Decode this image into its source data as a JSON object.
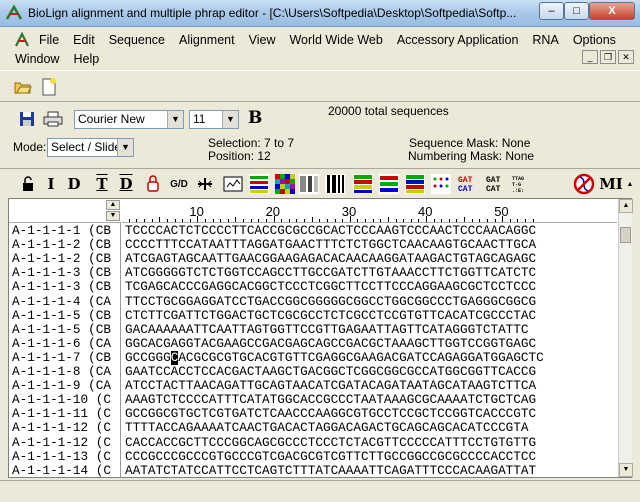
{
  "window": {
    "title": "BioLign alignment and multiple phrap editor - [C:\\Users\\Softpedia\\Desktop\\Softpedia\\Softp...",
    "minimize": "–",
    "maximize": "□",
    "close": "X"
  },
  "menu": {
    "row1": [
      "File",
      "Edit",
      "Sequence",
      "Alignment",
      "View",
      "World Wide Web",
      "Accessory Application",
      "RNA",
      "Options"
    ],
    "row2": [
      "Window",
      "Help"
    ]
  },
  "font_toolbar": {
    "font_name": "Courier New",
    "font_size": "11",
    "bold_label": "B",
    "total_sequences": "20000 total sequences"
  },
  "mode_bar": {
    "mode_label": "Mode:",
    "mode_value": "Select / Slide",
    "selection": "Selection: 7 to 7",
    "position": "Position:  12",
    "sequence_mask": "Sequence Mask: None",
    "numbering_mask": "Numbering Mask: None"
  },
  "edit_toolbar": {
    "labels": [
      "I",
      "D",
      "T",
      "D",
      "G/D"
    ],
    "mi_label": "MI"
  },
  "ruler": {
    "numbers": [
      "10",
      "20",
      "30",
      "40",
      "50"
    ]
  },
  "sequences": [
    {
      "name": "A-1-1-1-1 (CB",
      "seq": "TCCCCACTCTCCCCTTCACCGCGCCGCACTCCCAAGTCCCAACTCCCAACAGGC"
    },
    {
      "name": "A-1-1-1-2 (CB",
      "seq": "CCCCTTTCCATAATTTAGGATGAACTTTCTCTGGCTCAACAAGTGCAACTTGCA"
    },
    {
      "name": "A-1-1-1-2 (CB",
      "seq": "ATCGAGTAGCAATTGAACGGAAGAGACACAACAAGGATAAGACTGTAGCAGAGC"
    },
    {
      "name": "A-1-1-1-3 (CB",
      "seq": "ATCGGGGGTCTCTGGTCCAGCCTTGCCGATCTTGTAAACCTTCTGGTTCATCTC"
    },
    {
      "name": "A-1-1-1-3 (CB",
      "seq": "TCGAGCACCCGAGGCACGGCTCCCTCGGCTTCCTTCCCAGGAAGCGCTCCTCCC"
    },
    {
      "name": "A-1-1-1-4 (CA",
      "seq": "TTCCTGCGGAGGATCCTGACCGGCGGGGGCGGCCTGGCGGCCCTGAGGGCGGCG"
    },
    {
      "name": "A-1-1-1-5 (CB",
      "seq": "CTCTTCGATTCTGGACTGCTCGCGCCTCTCGCCTCCGTGTTCACATCGCCCTAC"
    },
    {
      "name": "A-1-1-1-5 (CB",
      "seq": "GACAAAAAATTCAATTAGTGGTTCCGTTGAGAATTAGTTCATAGGGTCTATTC"
    },
    {
      "name": "A-1-1-1-6 (CA",
      "seq": "GGCACGAGGTACGAAGCCGACGAGCAGCCGACGCTAAAGCTTGGTCCGGTGAGC"
    },
    {
      "name": "A-1-1-1-7 (CB",
      "seq_pre": "GCCGGG",
      "seq_cursor": "C",
      "seq_post": "ACGCGCGTGCACGTGTTCGAGGCGAAGACGATCCAGAGGATGGAGCTC"
    },
    {
      "name": "A-1-1-1-8 (CA",
      "seq": "GAATCCACCTCCACGACTAAGCTGACGGCTCGGCGGCGCCATGGCGGTTCACCG"
    },
    {
      "name": "A-1-1-1-9 (CA",
      "seq": "ATCCTACTTAACAGATTGCAGTAACATCGATACAGATAATAGCATAAGTCTTCA"
    },
    {
      "name": "A-1-1-1-10 (C",
      "seq": "AAAGTCTCCCCATTTCATATGGCACCGCCCTAATAAAGCGCAAAATCTGCTCAG"
    },
    {
      "name": "A-1-1-1-11 (C",
      "seq": "GCCGGCGTGCTCGTGATCTCAACCCAAGGCGTGCCTCCGCTCCGGTCACCCGTC"
    },
    {
      "name": "A-1-1-1-12 (C",
      "seq": "TTTTACCAGAAAATCAACTGACACTAGGACAGACTGCAGCAGCACATCCCGTA"
    },
    {
      "name": "A-1-1-1-12 (C",
      "seq": "CACCACCGCTTCCCGGCAGCGCCCTCCCTCTACGTTCCCCCATTTCCTGTGTTG"
    },
    {
      "name": "A-1-1-1-13 (C",
      "seq": "CCCGCCCGCCCGTGCCCGTCGACGCGTCGTTCTTGCCGGCCGCGCCCCACCTCC"
    },
    {
      "name": "A-1-1-1-14 (C",
      "seq": "AATATCTATCCATTCCTCAGTCTTTATCAAAATTCAGATTTCCCACAAGATTAT"
    }
  ]
}
